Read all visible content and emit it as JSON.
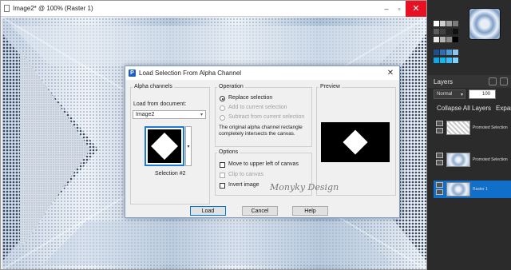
{
  "document": {
    "title": "Image2* @ 100% (Raster 1)",
    "controls": [
      "–",
      "▫",
      "✕"
    ]
  },
  "dialog": {
    "title": "Load Selection From Alpha Channel",
    "alpha_channels_label": "Alpha channels",
    "load_from_label": "Load from document:",
    "document_value": "Image2",
    "selection_label": "Selection #2",
    "operation_label": "Operation",
    "op_replace": "Replace selection",
    "op_add": "Add to current selection",
    "op_subtract": "Subtract from current selection",
    "description": "The original alpha channel rectangle completely intersects the canvas.",
    "options_label": "Options",
    "opt_move": "Move to upper left of canvas",
    "opt_clip": "Clip to canvas",
    "opt_invert": "Invert image",
    "preview_label": "Preview",
    "load_button": "Load",
    "cancel_button": "Cancel",
    "help_button": "Help",
    "watermark": "Monyky Design",
    "replace_selected": true
  },
  "layers": {
    "title": "Layers",
    "blend_mode": "Normal",
    "opacity": "100",
    "collapse_all": "Collapse All Layers",
    "expand_all": "Expand A",
    "items": [
      {
        "name": "Promoted Selection",
        "selected": false
      },
      {
        "name": "Promoted Selection",
        "selected": false
      },
      {
        "name": "Raster 1",
        "selected": true
      }
    ]
  },
  "colors": {
    "selection_blue": "#0f6fc9",
    "dialog_bg": "#f0f0f0",
    "panel_bg": "#2b2b2b",
    "close_red": "#e81123"
  }
}
